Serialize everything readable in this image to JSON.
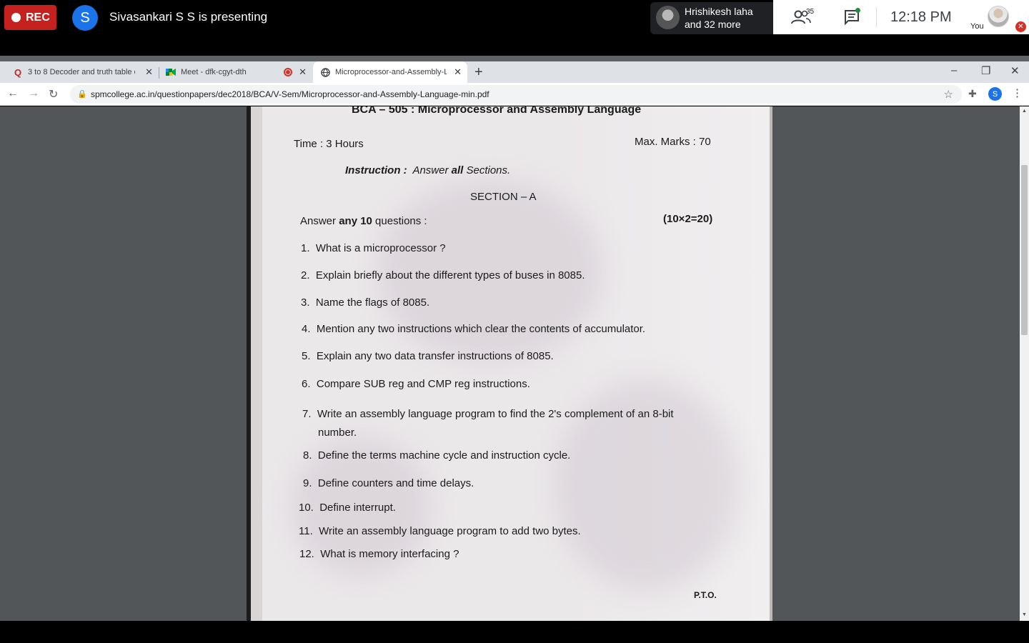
{
  "meet": {
    "rec_label": "REC",
    "presenter_initial": "S",
    "presenting_text": "Sivasankari S S is presenting",
    "speaker_name": "Hrishikesh laha",
    "speaker_more": "and 32 more",
    "people_count": "35",
    "time": "12:18 PM",
    "you_label": "You"
  },
  "browser": {
    "tabs": [
      {
        "title": "3 to 8 Decoder and truth table of",
        "favicon": "Q"
      },
      {
        "title": "Meet - dfk-cgyt-dth",
        "favicon": "meet-icon"
      },
      {
        "title": "Microprocessor-and-Assembly-L",
        "favicon": "globe-icon"
      }
    ],
    "url": "spmcollege.ac.in/questionpapers/dec2018/BCA/V-Sem/Microprocessor-and-Assembly-Language-min.pdf",
    "profile_initial": "S"
  },
  "pdf": {
    "title": "BCA – 505 : Microprocessor and Assembly Language",
    "time": "Time : 3 Hours",
    "max_marks": "Max. Marks : 70",
    "instruction_label": "Instruction :",
    "instruction_pre": "Answer ",
    "instruction_bold": "all",
    "instruction_post": " Sections.",
    "section": "SECTION – A",
    "answer_pre": "Answer ",
    "answer_bold": "any 10",
    "answer_post": " questions :",
    "score": "(10×2=20)",
    "questions": [
      {
        "num": "1.",
        "text": "What is a microprocessor ?"
      },
      {
        "num": "2.",
        "text": "Explain briefly about the different types of buses in 8085."
      },
      {
        "num": "3.",
        "text": "Name the flags of 8085."
      },
      {
        "num": "4.",
        "text": "Mention any two instructions which clear the contents of accumulator."
      },
      {
        "num": "5.",
        "text": "Explain any two data transfer instructions of 8085."
      },
      {
        "num": "6.",
        "text": "Compare SUB reg and CMP reg instructions."
      },
      {
        "num": "7.",
        "text": "Write an assembly language program to find the 2's complement of an 8-bit",
        "text2": "number."
      },
      {
        "num": "8.",
        "text": "Define the terms machine cycle and instruction cycle."
      },
      {
        "num": "9.",
        "text": "Define counters and time delays."
      },
      {
        "num": "10.",
        "text": "Define interrupt."
      },
      {
        "num": "11.",
        "text": "Write an assembly language program to add two bytes."
      },
      {
        "num": "12.",
        "text": "What is memory interfacing ?"
      }
    ],
    "pto": "P.T.O."
  }
}
